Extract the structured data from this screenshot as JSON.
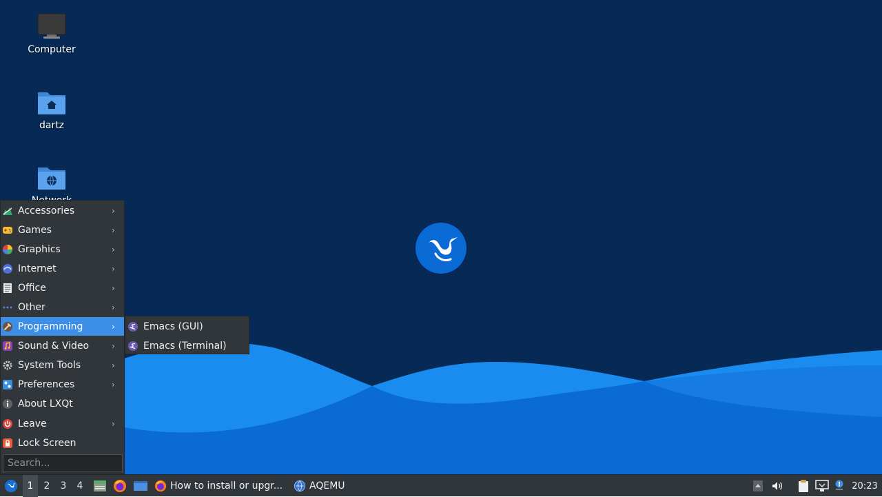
{
  "desktop": {
    "icons": [
      {
        "label": "Computer",
        "icon": "computer-icon"
      },
      {
        "label": "dartz",
        "icon": "home-folder-icon"
      },
      {
        "label": "Network",
        "icon": "network-folder-icon"
      }
    ],
    "wallpaper_colors": {
      "background": "#062a55",
      "wave_light": "#1a8cf0",
      "wave_dark": "#0a6ad6"
    }
  },
  "main_menu": {
    "items": [
      {
        "label": "Accessories",
        "icon": "accessories-icon",
        "submenu": true
      },
      {
        "label": "Games",
        "icon": "games-icon",
        "submenu": true
      },
      {
        "label": "Graphics",
        "icon": "graphics-icon",
        "submenu": true
      },
      {
        "label": "Internet",
        "icon": "internet-icon",
        "submenu": true
      },
      {
        "label": "Office",
        "icon": "office-icon",
        "submenu": true
      },
      {
        "label": "Other",
        "icon": "other-icon",
        "submenu": true
      },
      {
        "label": "Programming",
        "icon": "programming-icon",
        "submenu": true,
        "active": true
      },
      {
        "label": "Sound & Video",
        "icon": "sound-video-icon",
        "submenu": true
      },
      {
        "label": "System Tools",
        "icon": "system-tools-icon",
        "submenu": true
      },
      {
        "label": "Preferences",
        "icon": "preferences-icon",
        "submenu": true
      },
      {
        "label": "About LXQt",
        "icon": "info-icon",
        "submenu": false
      },
      {
        "label": "Leave",
        "icon": "power-icon",
        "submenu": true
      },
      {
        "label": "Lock Screen",
        "icon": "lock-icon",
        "submenu": false
      }
    ],
    "arrow": "›",
    "search_placeholder": "Search..."
  },
  "submenu": {
    "items": [
      {
        "label": "Emacs (GUI)",
        "icon": "emacs-icon"
      },
      {
        "label": "Emacs (Terminal)",
        "icon": "emacs-icon"
      }
    ]
  },
  "taskbar": {
    "workspaces": [
      "1",
      "2",
      "3",
      "4"
    ],
    "active_workspace": "1",
    "tasks": [
      {
        "label": "How to install or upgr...",
        "icon": "firefox-icon"
      },
      {
        "label": "AQEMU",
        "icon": "aqemu-icon"
      }
    ],
    "clock": "20:23",
    "accent": "#3d8ee6"
  }
}
